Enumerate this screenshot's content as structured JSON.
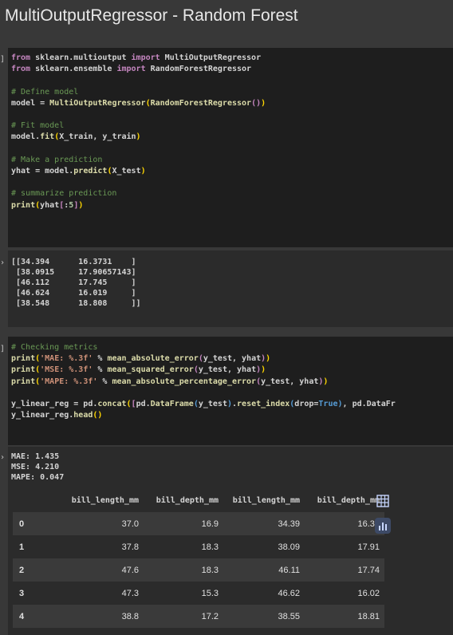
{
  "heading": "MultiOutputRegressor - Random Forest",
  "cell1": {
    "bracket": "]",
    "lines": [
      "from sklearn.multioutput import MultiOutputRegressor",
      "from sklearn.ensemble import RandomForestRegressor",
      "",
      "# Define model",
      "model = MultiOutputRegressor(RandomForestRegressor())",
      "",
      "# Fit model",
      "model.fit(X_train, y_train)",
      "",
      "# Make a prediction",
      "yhat = model.predict(X_test)",
      "",
      "# summarize prediction",
      "print(yhat[:5])"
    ]
  },
  "out1": {
    "lines": [
      "[[34.394      16.3731    ]",
      " [38.0915     17.90657143]",
      " [46.112      17.745     ]",
      " [46.624      16.019     ]",
      " [38.548      18.808     ]]"
    ]
  },
  "cell2": {
    "bracket": "]",
    "lines": [
      "# Checking metrics",
      "print('MAE: %.3f' % mean_absolute_error(y_test, yhat))",
      "print('MSE: %.3f' % mean_squared_error(y_test, yhat))",
      "print('MAPE: %.3f' % mean_absolute_percentage_error(y_test, yhat))",
      "",
      "y_linear_reg = pd.concat([pd.DataFrame(y_test).reset_index(drop=True), pd.DataFr",
      "y_linear_reg.head()"
    ]
  },
  "out2": {
    "metrics": [
      "MAE: 1.435",
      "MSE: 4.210",
      "MAPE: 0.047"
    ],
    "columns": [
      "",
      "bill_length_mm",
      "bill_depth_mm",
      "bill_length_mm",
      "bill_depth_mm"
    ],
    "rows": [
      [
        "0",
        "37.0",
        "16.9",
        "34.39",
        "16.37"
      ],
      [
        "1",
        "37.8",
        "18.3",
        "38.09",
        "17.91"
      ],
      [
        "2",
        "47.6",
        "18.3",
        "46.11",
        "17.74"
      ],
      [
        "3",
        "47.3",
        "15.3",
        "46.62",
        "16.02"
      ],
      [
        "4",
        "38.8",
        "17.2",
        "38.55",
        "18.81"
      ]
    ]
  },
  "icons": [
    "table-icon",
    "chart-icon"
  ],
  "colors": {
    "bg": "#383838",
    "code_bg": "#1e1e1e",
    "keyword": "#c586c0",
    "function": "#dcdcaa",
    "comment": "#6a9955",
    "string": "#ce9178",
    "icon_bg": "#3d4a66",
    "icon_fg": "#c7d6ff"
  }
}
